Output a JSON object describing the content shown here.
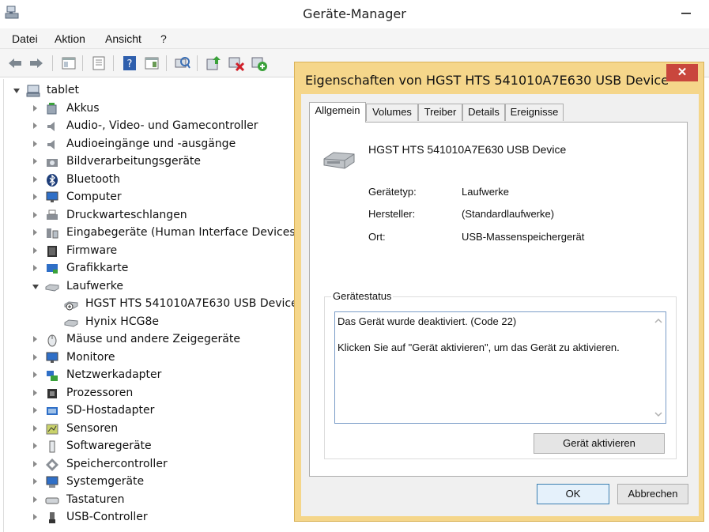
{
  "window": {
    "title": "Geräte-Manager",
    "icons": {
      "app": "device-manager-icon",
      "minimize": "minimize-icon"
    }
  },
  "menu": [
    "Datei",
    "Aktion",
    "Ansicht",
    "?"
  ],
  "toolbar": {
    "icons": [
      "back-arrow-icon",
      "forward-arrow-icon",
      "show-hide-console-tree-icon",
      "properties-icon",
      "help-icon",
      "action-pane-icon",
      "scan-hardware-icon",
      "update-driver-icon",
      "uninstall-device-icon",
      "enable-device-icon"
    ]
  },
  "tree": {
    "root": {
      "label": "tablet",
      "icon": "computer-icon"
    },
    "categories": [
      {
        "label": "Akkus",
        "icon": "battery-icon"
      },
      {
        "label": "Audio-, Video- und Gamecontroller",
        "icon": "speaker-icon"
      },
      {
        "label": "Audioeingänge und -ausgänge",
        "icon": "speaker-icon"
      },
      {
        "label": "Bildverarbeitungsgeräte",
        "icon": "camera-icon"
      },
      {
        "label": "Bluetooth",
        "icon": "bluetooth-icon"
      },
      {
        "label": "Computer",
        "icon": "monitor-icon"
      },
      {
        "label": "Druckwarteschlangen",
        "icon": "printer-icon"
      },
      {
        "label": "Eingabegeräte (Human Interface Devices)",
        "icon": "hid-icon"
      },
      {
        "label": "Firmware",
        "icon": "chip-icon"
      },
      {
        "label": "Grafikkarte",
        "icon": "display-adapter-icon"
      },
      {
        "label": "Laufwerke",
        "icon": "disk-drive-icon",
        "expanded": true,
        "children": [
          {
            "label": "HGST HTS 541010A7E630 USB Device",
            "icon": "disabled-drive-icon"
          },
          {
            "label": "Hynix HCG8e",
            "icon": "disk-drive-icon"
          }
        ]
      },
      {
        "label": "Mäuse und andere Zeigegeräte",
        "icon": "mouse-icon"
      },
      {
        "label": "Monitore",
        "icon": "monitor-icon"
      },
      {
        "label": "Netzwerkadapter",
        "icon": "network-icon"
      },
      {
        "label": "Prozessoren",
        "icon": "processor-icon"
      },
      {
        "label": "SD-Hostadapter",
        "icon": "sd-card-icon"
      },
      {
        "label": "Sensoren",
        "icon": "sensor-icon"
      },
      {
        "label": "Softwaregeräte",
        "icon": "software-device-icon"
      },
      {
        "label": "Speichercontroller",
        "icon": "storage-controller-icon"
      },
      {
        "label": "Systemgeräte",
        "icon": "system-device-icon"
      },
      {
        "label": "Tastaturen",
        "icon": "keyboard-icon"
      },
      {
        "label": "USB-Controller",
        "icon": "usb-icon"
      }
    ]
  },
  "dialog": {
    "title": "Eigenschaften von HGST HTS 541010A7E630 USB Device",
    "close_label": "✕",
    "tabs": [
      "Allgemein",
      "Volumes",
      "Treiber",
      "Details",
      "Ereignisse"
    ],
    "active_tab": "Allgemein",
    "device_name": "HGST HTS 541010A7E630 USB Device",
    "device_icon": "disk-drive-icon",
    "properties": [
      {
        "label": "Gerätetyp:",
        "value": "Laufwerke"
      },
      {
        "label": "Hersteller:",
        "value": "(Standardlaufwerke)"
      },
      {
        "label": "Ort:",
        "value": "USB-Massenspeichergerät"
      }
    ],
    "status_group_label": "Gerätestatus",
    "status_text_line1": "Das Gerät wurde deaktiviert. (Code 22)",
    "status_text_line2": "Klicken Sie auf \"Gerät aktivieren\", um das Gerät zu aktivieren.",
    "enable_button": "Gerät aktivieren",
    "ok_button": "OK",
    "cancel_button": "Abbrechen"
  }
}
